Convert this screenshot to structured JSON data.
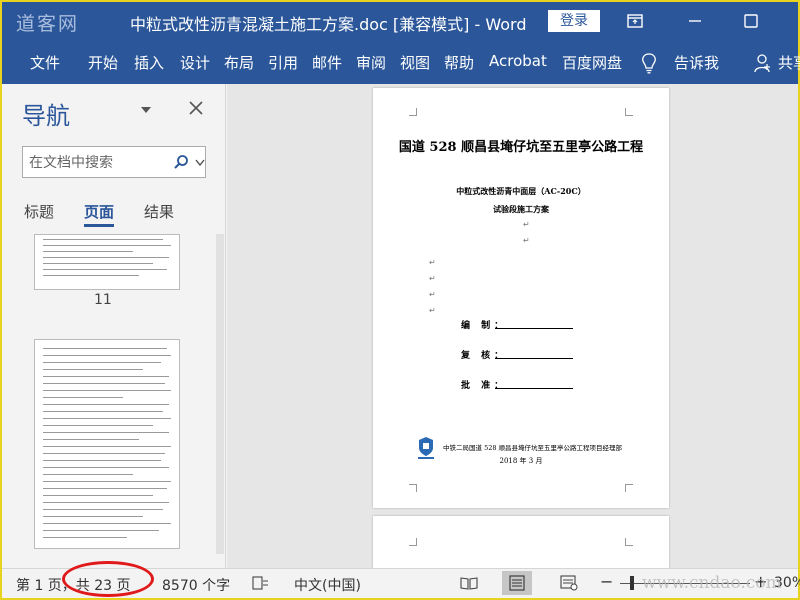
{
  "window": {
    "logo_watermark": "道客网",
    "title": "中粒式改性沥青混凝土施工方案.doc [兼容模式] - Word",
    "login_label": "登录"
  },
  "ribbon": {
    "tabs": [
      "文件",
      "开始",
      "插入",
      "设计",
      "布局",
      "引用",
      "邮件",
      "审阅",
      "视图",
      "帮助",
      "Acrobat",
      "百度网盘"
    ],
    "tell_me": "告诉我",
    "share": "共享"
  },
  "nav_pane": {
    "title": "导航",
    "search_placeholder": "在文档中搜索",
    "tabs": [
      "标题",
      "页面",
      "结果"
    ],
    "active_tab": "页面",
    "thumb_page_number": "11"
  },
  "document": {
    "title": "国道 528 顺昌县埯仔坑至五里亭公路工程",
    "subtitle1": "中粒式改性沥青中面层（AC-20C）",
    "subtitle2": "试验段施工方案",
    "sign_labels": [
      "编 制：",
      "复 核：",
      "批 准："
    ],
    "org": "中铁二局国道 528 顺昌县埯仔坑至五里亭公路工程项目经理部",
    "date": "2018 年 3 月"
  },
  "statusbar": {
    "page_info": "第 1 页，共 23 页",
    "word_count": "8570 个字",
    "language": "中文(中国)",
    "zoom": "30%",
    "watermark": "www.cndao.com"
  },
  "colors": {
    "accent": "#2b579a",
    "highlight_circle": "#e0191b",
    "frame": "#e8d31e"
  }
}
